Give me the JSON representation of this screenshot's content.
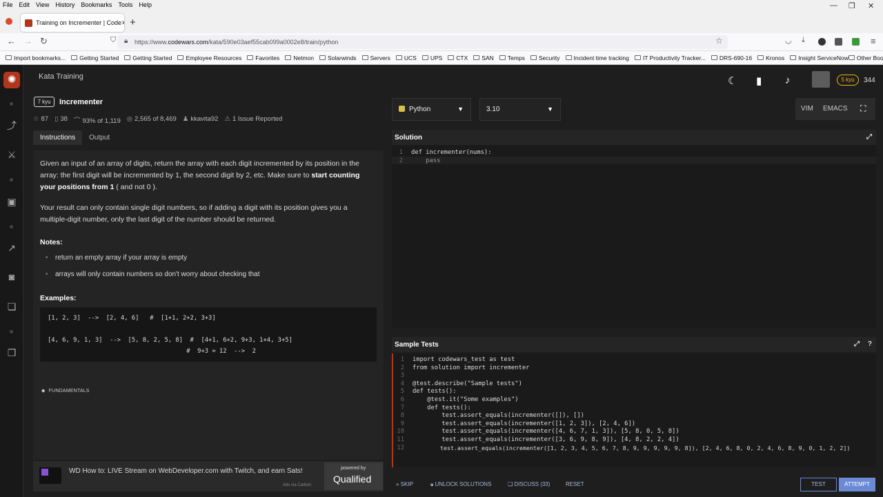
{
  "browser": {
    "menu": [
      "File",
      "Edit",
      "View",
      "History",
      "Bookmarks",
      "Tools",
      "Help"
    ],
    "tab_title": "Training on Incrementer | Code",
    "url_prefix": "https://www.",
    "url_domain": "codewars.com",
    "url_path": "/kata/590e03aef55cab099a0002e8/train/python",
    "bookmarks": [
      "Import bookmarks...",
      "Getting Started",
      "Getting Started",
      "Employee Resources",
      "Favorites",
      "Netmon",
      "Solarwinds",
      "Servers",
      "UCS",
      "UPS",
      "CTX",
      "SAN",
      "Temps",
      "Security",
      "Incident time tracking",
      "IT Productivity Tracker...",
      "DRS-690-16",
      "Kronos",
      "Insight ServiceNow"
    ],
    "other_bookmarks": "Other Bookmarks"
  },
  "header": {
    "title": "Kata Training",
    "rank": "5 kyu",
    "honor": "344"
  },
  "kata": {
    "kyu": "7 kyu",
    "name": "Incrementer",
    "stars": "87",
    "collections": "38",
    "satisfaction": "93% of 1,119",
    "completed": "2,565 of 8,469",
    "author": "kkavita92",
    "issues": "1 Issue Reported"
  },
  "left_tabs": {
    "instructions": "Instructions",
    "output": "Output"
  },
  "instructions": {
    "p1_a": "Given an input of an array of digits, return the array with each digit incremented by its position in the array: the first digit will be incremented by 1, the second digit by 2, etc. Make sure to ",
    "p1_bold": "start counting your positions from 1",
    "p1_b": " ( and not 0 ).",
    "p2": "Your result can only contain single digit numbers, so if adding a digit with its position gives you a multiple-digit number, only the last digit of the number should be returned.",
    "notes_heading": "Notes:",
    "notes": [
      "return an empty array if your array is empty",
      "arrays will only contain numbers so don't worry about checking that"
    ],
    "examples_heading": "Examples:",
    "example_lines": [
      "[1, 2, 3]  -->  [2, 4, 6]   #  [1+1, 2+2, 3+3]",
      "[4, 6, 9, 1, 3]  -->  [5, 8, 2, 5, 8]  #  [4+1, 6+2, 9+3, 1+4, 3+5]",
      "                                      #  9+3 = 12  -->  2"
    ],
    "tag": "FUNDAMENTALS"
  },
  "ad": {
    "text": "WD How to: LIVE Stream on WebDeveloper.com with Twitch, and earn Sats!",
    "small": "Ads via Carbon",
    "powered_by": "powered by",
    "brand": "Qualified"
  },
  "editor": {
    "language": "Python",
    "version": "3.10",
    "mode_vim": "VIM",
    "mode_emacs": "EMACS",
    "solution_title": "Solution",
    "solution_lines": [
      "def incrementer(nums):",
      "    pass"
    ],
    "tests_title": "Sample Tests",
    "test_lines": [
      "import codewars_test as test",
      "from solution import incrementer",
      "",
      "@test.describe(\"Sample tests\")",
      "def tests():",
      "    @test.it(\"Some examples\")",
      "    def tests():",
      "        test.assert_equals(incrementer([]), [])",
      "        test.assert_equals(incrementer([1, 2, 3]), [2, 4, 6])",
      "        test.assert_equals(incrementer([4, 6, 7, 1, 3]), [5, 8, 0, 5, 8])",
      "        test.assert_equals(incrementer([3, 6, 9, 8, 9]), [4, 8, 2, 2, 4])",
      "        test.assert_equals(incrementer([1, 2, 3, 4, 5, 6, 7, 8, 9, 9, 9, 9, 9, 8]), [2, 4, 6, 8, 0, 2, 4, 6, 8, 9, 0, 1, 2, 2])"
    ]
  },
  "actions": {
    "skip": "SKIP",
    "unlock": "UNLOCK SOLUTIONS",
    "discuss": "DISCUSS (33)",
    "reset": "RESET",
    "test": "TEST",
    "attempt": "ATTEMPT"
  }
}
